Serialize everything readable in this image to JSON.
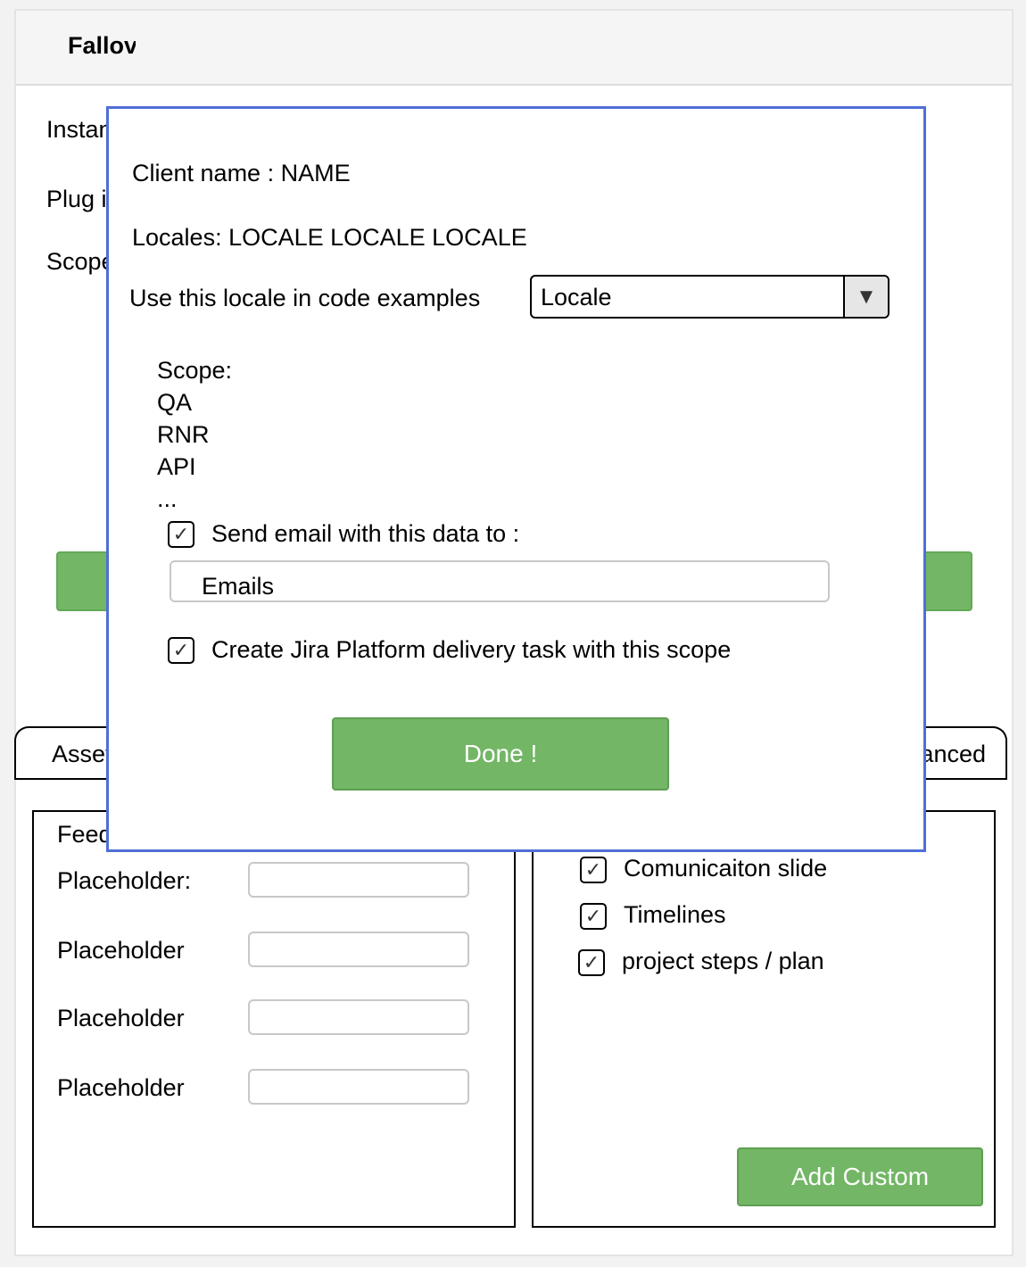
{
  "header": {
    "title": "Fallover"
  },
  "background": {
    "labels": [
      "Instance",
      "Plug in",
      "Scope"
    ],
    "tabs": {
      "left": "Assets",
      "right": "Advanced"
    },
    "feedback_title": "Feedback",
    "placeholders": [
      "Placeholder:",
      "Placeholder",
      "Placeholder",
      "Placeholder"
    ],
    "checklist": [
      {
        "label": "Comunicaiton slide",
        "checked": true
      },
      {
        "label": "Timelines",
        "checked": true
      },
      {
        "label": "project steps / plan",
        "checked": true
      }
    ],
    "add_custom_label": "Add Custom"
  },
  "modal": {
    "client_name": "Client name : NAME",
    "locales": "Locales: LOCALE LOCALE LOCALE",
    "locale_prompt": "Use this locale in code examples",
    "locale_select": {
      "value": "Locale",
      "arrow": "▼"
    },
    "scope_title": "Scope:",
    "scope_items": [
      "QA",
      "RNR",
      "API",
      "..."
    ],
    "send_email": {
      "label": "Send email with this data to :",
      "checked": true
    },
    "emails_field": "Emails",
    "create_jira": {
      "label": "Create Jira Platform delivery task with this scope",
      "checked": true
    },
    "done_label": "Done !",
    "check_glyph": "✓"
  },
  "colors": {
    "accent_green": "#73b666",
    "modal_border": "#4f6fd6"
  }
}
